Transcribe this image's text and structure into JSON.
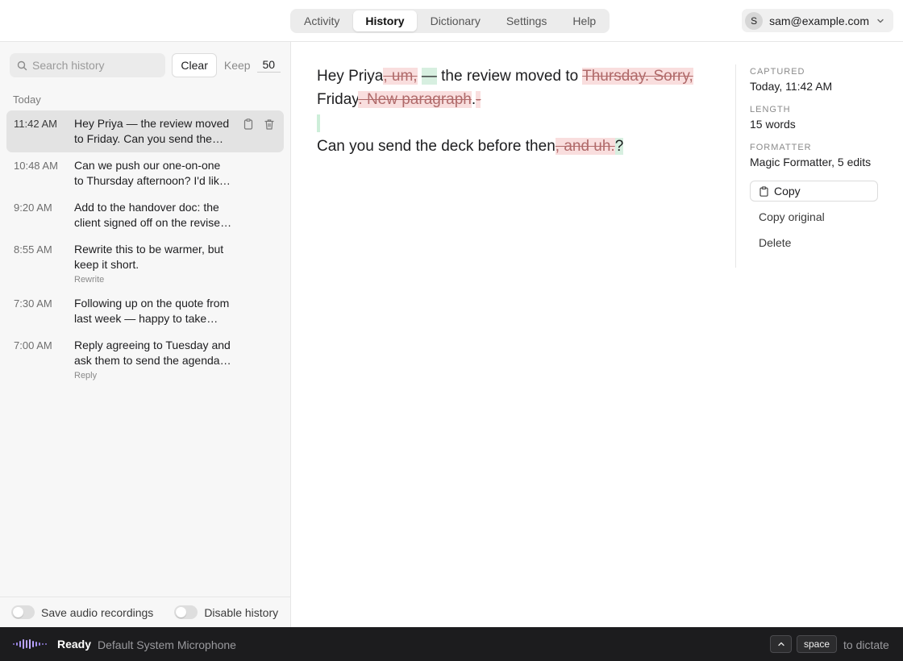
{
  "nav": {
    "tabs": [
      {
        "label": "Activity"
      },
      {
        "label": "History"
      },
      {
        "label": "Dictionary"
      },
      {
        "label": "Settings"
      },
      {
        "label": "Help"
      }
    ],
    "active_tab": "History",
    "account": {
      "initial": "S",
      "email": "sam@example.com"
    }
  },
  "history": {
    "search_placeholder": "Search history",
    "clear_label": "Clear",
    "keep_label": "Keep",
    "keep_value": "50",
    "section_label": "Today",
    "items": [
      {
        "time": "11:42 AM",
        "text": "Hey Priya — the review moved to Friday. Can you send the deck before then?",
        "tag": ""
      },
      {
        "time": "10:48 AM",
        "text": "Can we push our one-on-one to Thursday afternoon? I'd like to prep first.",
        "tag": ""
      },
      {
        "time": "9:20 AM",
        "text": "Add to the handover doc: the client signed off on the revised scope.",
        "tag": ""
      },
      {
        "time": "8:55 AM",
        "text": "Rewrite this to be warmer, but keep it short.",
        "tag": "Rewrite"
      },
      {
        "time": "7:30 AM",
        "text": "Following up on the quote from last week — happy to take questions.",
        "tag": ""
      },
      {
        "time": "7:00 AM",
        "text": "Reply agreeing to Tuesday and ask them to send the agenda ahead of time.",
        "tag": "Reply"
      }
    ]
  },
  "toggles": {
    "save_audio": "Save audio recordings",
    "disable_history": "Disable history"
  },
  "editor": {
    "seg1": "Hey Priya",
    "del1": ", um,",
    "ins1": "—",
    "seg2": "the review moved to",
    "del2": "Thursday. Sorry,",
    "seg3": "Friday",
    "del3": ". New paragraph",
    "seg4": ".",
    "del4": "-",
    "seg5": "Can you send the deck before then",
    "del5": ", and uh.",
    "ins5": "?"
  },
  "meta": {
    "captured_label": "CAPTURED",
    "captured_value": "Today, 11:42 AM",
    "length_label": "LENGTH",
    "length_value": "15 words",
    "formatter_label": "FORMATTER",
    "formatter_value": "Magic Formatter, 5 edits",
    "copy_label": "Copy",
    "copy_original_label": "Copy original",
    "delete_label": "Delete"
  },
  "status": {
    "ready": "Ready",
    "mic": "Default System Microphone",
    "space_key": "space",
    "dictate_hint": "to dictate"
  },
  "colors": {
    "deletion_bg": "#f9dede",
    "insertion_bg": "#d7efe0",
    "wave_accent": "#b9a2ff",
    "statusbar_bg": "#1c1c1e"
  }
}
